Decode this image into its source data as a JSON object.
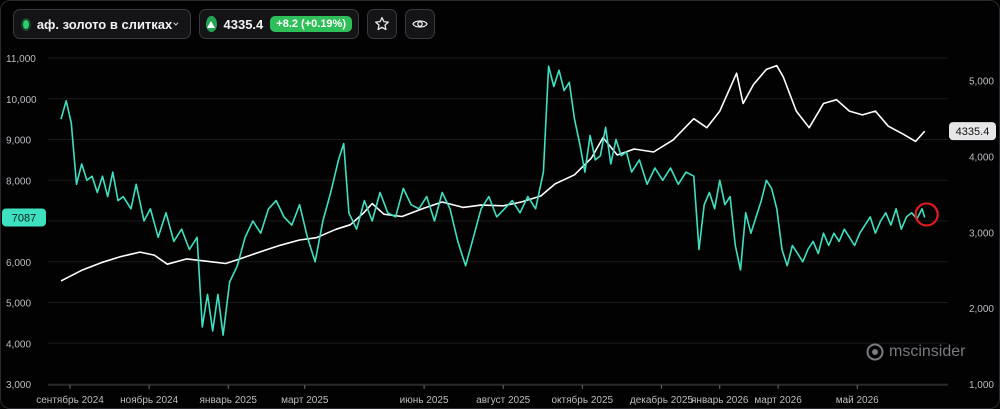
{
  "toolbar": {
    "asset_name": "аф. золото в слитках",
    "price": "4335.4",
    "change": "+8.2 (+0.19%)",
    "icons": [
      "status-dot-icon",
      "chevron-down-icon",
      "up-triangle-icon",
      "star-icon",
      "eye-icon"
    ]
  },
  "watermark": "mscinsider",
  "colors": {
    "gold_line": "#ffffff",
    "cot_line": "#3fe0c0",
    "marker": "#e01b1b",
    "up": "#2fbf58"
  },
  "chart_data": {
    "type": "line",
    "x_labels": [
      "сентябрь 2024",
      "ноябрь 2024",
      "январь 2025",
      "март 2025",
      "июнь 2025",
      "август 2025",
      "октябрь 2025",
      "декабрь 2025",
      "январь 2026",
      "март 2026",
      "май 2026"
    ],
    "x_start": "2024-08-15",
    "x_end": "2026-07-10",
    "x_label_dates": [
      "2024-09-01",
      "2024-11-01",
      "2025-01-01",
      "2025-03-01",
      "2025-06-01",
      "2025-08-01",
      "2025-10-01",
      "2025-12-01",
      "2026-01-15",
      "2026-03-01",
      "2026-05-01"
    ],
    "left_axis": {
      "ticks": [
        "3,000",
        "4,000",
        "5,000",
        "6,000",
        "7,000",
        "8,000",
        "9,000",
        "10,000",
        "11,000"
      ],
      "min": 3000,
      "max": 11000
    },
    "right_axis": {
      "ticks": [
        "1,000",
        "2,000",
        "3,000",
        "4,000",
        "5,000"
      ],
      "min": 1000,
      "max": 5300
    },
    "left_current": "7087",
    "right_current": "4335.4",
    "series": [
      {
        "axis": "right",
        "color": "#ffffff",
        "points": [
          [
            "2024-08-25",
            2360
          ],
          [
            "2024-09-10",
            2500
          ],
          [
            "2024-09-25",
            2600
          ],
          [
            "2024-10-10",
            2680
          ],
          [
            "2024-10-25",
            2740
          ],
          [
            "2024-11-05",
            2700
          ],
          [
            "2024-11-15",
            2580
          ],
          [
            "2024-11-30",
            2650
          ],
          [
            "2024-12-15",
            2620
          ],
          [
            "2024-12-30",
            2590
          ],
          [
            "2025-01-10",
            2650
          ],
          [
            "2025-01-25",
            2740
          ],
          [
            "2025-02-10",
            2830
          ],
          [
            "2025-02-25",
            2900
          ],
          [
            "2025-03-10",
            2930
          ],
          [
            "2025-03-25",
            3040
          ],
          [
            "2025-04-05",
            3100
          ],
          [
            "2025-04-15",
            3250
          ],
          [
            "2025-04-22",
            3380
          ],
          [
            "2025-05-01",
            3240
          ],
          [
            "2025-05-15",
            3210
          ],
          [
            "2025-06-01",
            3320
          ],
          [
            "2025-06-15",
            3400
          ],
          [
            "2025-07-01",
            3330
          ],
          [
            "2025-07-15",
            3360
          ],
          [
            "2025-08-01",
            3350
          ],
          [
            "2025-08-15",
            3400
          ],
          [
            "2025-08-30",
            3480
          ],
          [
            "2025-09-10",
            3640
          ],
          [
            "2025-09-25",
            3760
          ],
          [
            "2025-10-08",
            3980
          ],
          [
            "2025-10-17",
            4250
          ],
          [
            "2025-10-28",
            4020
          ],
          [
            "2025-11-10",
            4100
          ],
          [
            "2025-11-25",
            4060
          ],
          [
            "2025-12-10",
            4220
          ],
          [
            "2025-12-26",
            4500
          ],
          [
            "2026-01-05",
            4380
          ],
          [
            "2026-01-15",
            4600
          ],
          [
            "2026-01-28",
            5100
          ],
          [
            "2026-02-02",
            4700
          ],
          [
            "2026-02-10",
            4950
          ],
          [
            "2026-02-20",
            5150
          ],
          [
            "2026-02-28",
            5200
          ],
          [
            "2026-03-05",
            5050
          ],
          [
            "2026-03-15",
            4600
          ],
          [
            "2026-03-25",
            4380
          ],
          [
            "2026-04-05",
            4700
          ],
          [
            "2026-04-15",
            4750
          ],
          [
            "2026-04-25",
            4600
          ],
          [
            "2026-05-05",
            4550
          ],
          [
            "2026-05-15",
            4600
          ],
          [
            "2026-05-25",
            4400
          ],
          [
            "2026-06-05",
            4300
          ],
          [
            "2026-06-15",
            4200
          ],
          [
            "2026-06-22",
            4335
          ]
        ]
      },
      {
        "axis": "left",
        "color": "#3fe0c0",
        "points": [
          [
            "2024-08-25",
            9500
          ],
          [
            "2024-08-29",
            9950
          ],
          [
            "2024-09-02",
            9400
          ],
          [
            "2024-09-06",
            7900
          ],
          [
            "2024-09-10",
            8400
          ],
          [
            "2024-09-14",
            8000
          ],
          [
            "2024-09-18",
            8100
          ],
          [
            "2024-09-22",
            7700
          ],
          [
            "2024-09-26",
            8100
          ],
          [
            "2024-09-30",
            7600
          ],
          [
            "2024-10-04",
            8200
          ],
          [
            "2024-10-08",
            7500
          ],
          [
            "2024-10-12",
            7600
          ],
          [
            "2024-10-18",
            7300
          ],
          [
            "2024-10-22",
            7900
          ],
          [
            "2024-10-28",
            7000
          ],
          [
            "2024-11-02",
            7300
          ],
          [
            "2024-11-08",
            6600
          ],
          [
            "2024-11-14",
            7200
          ],
          [
            "2024-11-20",
            6500
          ],
          [
            "2024-11-26",
            6800
          ],
          [
            "2024-12-02",
            6300
          ],
          [
            "2024-12-08",
            6600
          ],
          [
            "2024-12-12",
            4400
          ],
          [
            "2024-12-16",
            5200
          ],
          [
            "2024-12-20",
            4300
          ],
          [
            "2024-12-24",
            5200
          ],
          [
            "2024-12-28",
            4200
          ],
          [
            "2025-01-02",
            5500
          ],
          [
            "2025-01-08",
            5900
          ],
          [
            "2025-01-14",
            6600
          ],
          [
            "2025-01-20",
            7000
          ],
          [
            "2025-01-26",
            6700
          ],
          [
            "2025-02-01",
            7300
          ],
          [
            "2025-02-07",
            7500
          ],
          [
            "2025-02-13",
            7100
          ],
          [
            "2025-02-19",
            6900
          ],
          [
            "2025-02-25",
            7400
          ],
          [
            "2025-03-03",
            6600
          ],
          [
            "2025-03-09",
            6000
          ],
          [
            "2025-03-15",
            7000
          ],
          [
            "2025-03-21",
            7700
          ],
          [
            "2025-03-27",
            8500
          ],
          [
            "2025-03-31",
            8900
          ],
          [
            "2025-04-04",
            7200
          ],
          [
            "2025-04-10",
            6800
          ],
          [
            "2025-04-16",
            7500
          ],
          [
            "2025-04-22",
            7000
          ],
          [
            "2025-04-28",
            7700
          ],
          [
            "2025-05-04",
            7200
          ],
          [
            "2025-05-10",
            7100
          ],
          [
            "2025-05-16",
            7800
          ],
          [
            "2025-05-22",
            7400
          ],
          [
            "2025-05-28",
            7300
          ],
          [
            "2025-06-03",
            7600
          ],
          [
            "2025-06-09",
            7000
          ],
          [
            "2025-06-15",
            7700
          ],
          [
            "2025-06-21",
            7300
          ],
          [
            "2025-06-27",
            6500
          ],
          [
            "2025-07-03",
            5900
          ],
          [
            "2025-07-09",
            6600
          ],
          [
            "2025-07-15",
            7300
          ],
          [
            "2025-07-21",
            7600
          ],
          [
            "2025-07-27",
            7100
          ],
          [
            "2025-08-02",
            7300
          ],
          [
            "2025-08-08",
            7500
          ],
          [
            "2025-08-14",
            7200
          ],
          [
            "2025-08-20",
            7600
          ],
          [
            "2025-08-26",
            7300
          ],
          [
            "2025-09-01",
            8200
          ],
          [
            "2025-09-05",
            10800
          ],
          [
            "2025-09-09",
            10300
          ],
          [
            "2025-09-13",
            10700
          ],
          [
            "2025-09-17",
            10200
          ],
          [
            "2025-09-21",
            10400
          ],
          [
            "2025-09-25",
            9500
          ],
          [
            "2025-09-29",
            8900
          ],
          [
            "2025-10-03",
            8200
          ],
          [
            "2025-10-07",
            9100
          ],
          [
            "2025-10-11",
            8500
          ],
          [
            "2025-10-15",
            8600
          ],
          [
            "2025-10-19",
            9300
          ],
          [
            "2025-10-23",
            8400
          ],
          [
            "2025-10-27",
            9000
          ],
          [
            "2025-10-31",
            8600
          ],
          [
            "2025-11-04",
            8700
          ],
          [
            "2025-11-08",
            8200
          ],
          [
            "2025-11-14",
            8500
          ],
          [
            "2025-11-20",
            7900
          ],
          [
            "2025-11-26",
            8300
          ],
          [
            "2025-12-02",
            8000
          ],
          [
            "2025-12-08",
            8300
          ],
          [
            "2025-12-14",
            7900
          ],
          [
            "2025-12-20",
            8200
          ],
          [
            "2025-12-26",
            8100
          ],
          [
            "2025-12-30",
            6300
          ],
          [
            "2026-01-03",
            7400
          ],
          [
            "2026-01-07",
            7700
          ],
          [
            "2026-01-11",
            7300
          ],
          [
            "2026-01-15",
            8000
          ],
          [
            "2026-01-19",
            7400
          ],
          [
            "2026-01-23",
            7600
          ],
          [
            "2026-01-27",
            6400
          ],
          [
            "2026-01-31",
            5800
          ],
          [
            "2026-02-04",
            7200
          ],
          [
            "2026-02-08",
            6700
          ],
          [
            "2026-02-12",
            7100
          ],
          [
            "2026-02-16",
            7500
          ],
          [
            "2026-02-20",
            8000
          ],
          [
            "2026-02-24",
            7800
          ],
          [
            "2026-02-28",
            7300
          ],
          [
            "2026-03-04",
            6300
          ],
          [
            "2026-03-08",
            5900
          ],
          [
            "2026-03-12",
            6400
          ],
          [
            "2026-03-16",
            6200
          ],
          [
            "2026-03-20",
            6000
          ],
          [
            "2026-03-24",
            6300
          ],
          [
            "2026-03-28",
            6500
          ],
          [
            "2026-04-01",
            6200
          ],
          [
            "2026-04-05",
            6700
          ],
          [
            "2026-04-09",
            6400
          ],
          [
            "2026-04-13",
            6700
          ],
          [
            "2026-04-17",
            6500
          ],
          [
            "2026-04-21",
            6800
          ],
          [
            "2026-04-25",
            6600
          ],
          [
            "2026-04-29",
            6400
          ],
          [
            "2026-05-03",
            6700
          ],
          [
            "2026-05-07",
            6900
          ],
          [
            "2026-05-11",
            7100
          ],
          [
            "2026-05-15",
            6700
          ],
          [
            "2026-05-19",
            7000
          ],
          [
            "2026-05-23",
            7200
          ],
          [
            "2026-05-27",
            6900
          ],
          [
            "2026-05-31",
            7300
          ],
          [
            "2026-06-04",
            6800
          ],
          [
            "2026-06-08",
            7100
          ],
          [
            "2026-06-12",
            7200
          ],
          [
            "2026-06-16",
            7050
          ],
          [
            "2026-06-20",
            7300
          ],
          [
            "2026-06-22",
            7087
          ]
        ]
      }
    ],
    "highlight": "2026-06-22",
    "grid": true
  }
}
